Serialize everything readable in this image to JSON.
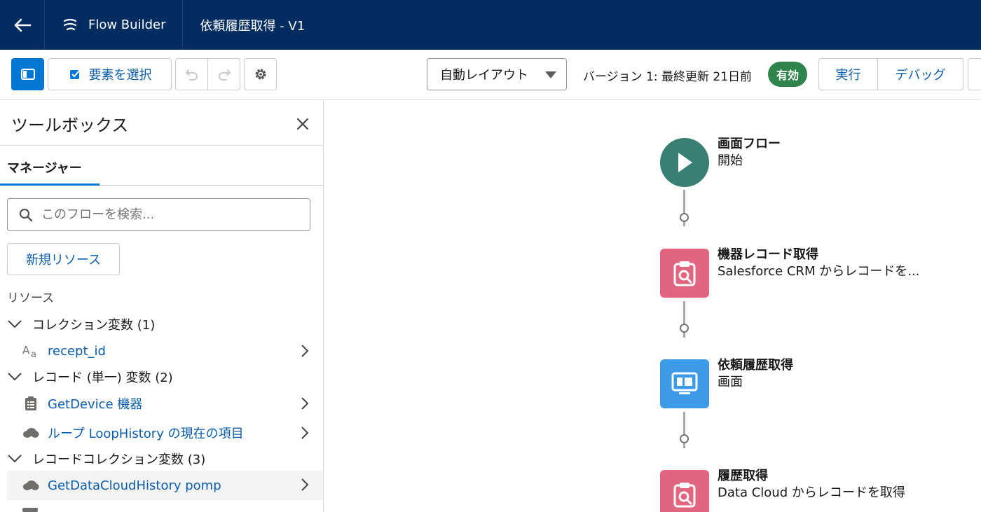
{
  "header": {
    "app_name": "Flow Builder",
    "flow_title": "依頼履歴取得 - V1"
  },
  "toolbar": {
    "select_elements_label": "要素を選択",
    "layout_dropdown_value": "自動レイアウト",
    "version_text": "バージョン 1: 最終更新 21日前",
    "status_badge": "有効",
    "run_label": "実行",
    "debug_label": "デバッグ"
  },
  "sidebar": {
    "title": "ツールボックス",
    "tab_manager": "マネージャー",
    "search_placeholder": "このフローを検索...",
    "new_resource_label": "新規リソース",
    "resources_label": "リソース",
    "sections": [
      {
        "label": "コレクション変数 (1)"
      },
      {
        "label": "レコード (単一) 変数 (2)"
      },
      {
        "label": "レコードコレクション変数 (3)"
      }
    ],
    "items": [
      {
        "label": "recept_id",
        "icon": "text-variable-icon"
      },
      {
        "label": "GetDevice 機器",
        "icon": "record-icon"
      },
      {
        "label": "ループ LoopHistory の現在の項目",
        "icon": "cloud-icon"
      },
      {
        "label": "GetDataCloudHistory pomp",
        "icon": "cloud-icon"
      }
    ]
  },
  "canvas": {
    "nodes": [
      {
        "title": "画面フロー",
        "subtitle": "開始",
        "icon": "play-icon",
        "color": "#3a7f73"
      },
      {
        "title": "機器レコード取得",
        "subtitle": "Salesforce CRM からレコードを...",
        "icon": "get-records-icon",
        "color": "#e2657f"
      },
      {
        "title": "依頼履歴取得",
        "subtitle": "画面",
        "icon": "screen-icon",
        "color": "#3d9ae6"
      },
      {
        "title": "履歴取得",
        "subtitle": "Data Cloud からレコードを取得",
        "icon": "get-records-icon",
        "color": "#e2657f"
      }
    ]
  },
  "colors": {
    "header_bg": "#032d60",
    "brand": "#0176d3",
    "link": "#0b5cab",
    "active_badge": "#2e844a"
  }
}
